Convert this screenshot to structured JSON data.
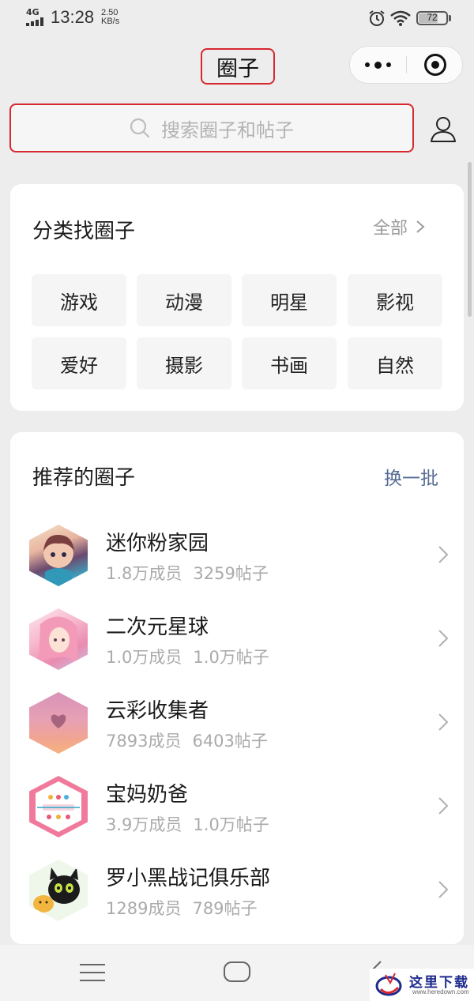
{
  "status_bar": {
    "network": "4G",
    "time": "13:28",
    "speed_value": "2.50",
    "speed_unit": "KB/s",
    "battery": "72",
    "battery_level": 0.72
  },
  "nav": {
    "title": "圈子"
  },
  "search": {
    "placeholder": "搜索圈子和帖子"
  },
  "categories": {
    "title": "分类找圈子",
    "all_label": "全部",
    "items": [
      "游戏",
      "动漫",
      "明星",
      "影视",
      "爱好",
      "摄影",
      "书画",
      "自然"
    ]
  },
  "recommended": {
    "title": "推荐的圈子",
    "refresh_label": "换一批",
    "items": [
      {
        "name": "迷你粉家园",
        "members": "1.8万成员",
        "posts": "3259帖子"
      },
      {
        "name": "二次元星球",
        "members": "1.0万成员",
        "posts": "1.0万帖子"
      },
      {
        "name": "云彩收集者",
        "members": "7893成员",
        "posts": "6403帖子"
      },
      {
        "name": "宝妈奶爸",
        "members": "3.9万成员",
        "posts": "1.0万帖子"
      },
      {
        "name": "罗小黑战记俱乐部",
        "members": "1289成员",
        "posts": "789帖子"
      }
    ]
  },
  "watermark": {
    "text": "这里下载",
    "url": "www.heredown.com"
  },
  "colors": {
    "accent_red": "#d6282f",
    "link_blue": "#576b95",
    "background": "#ededed"
  }
}
